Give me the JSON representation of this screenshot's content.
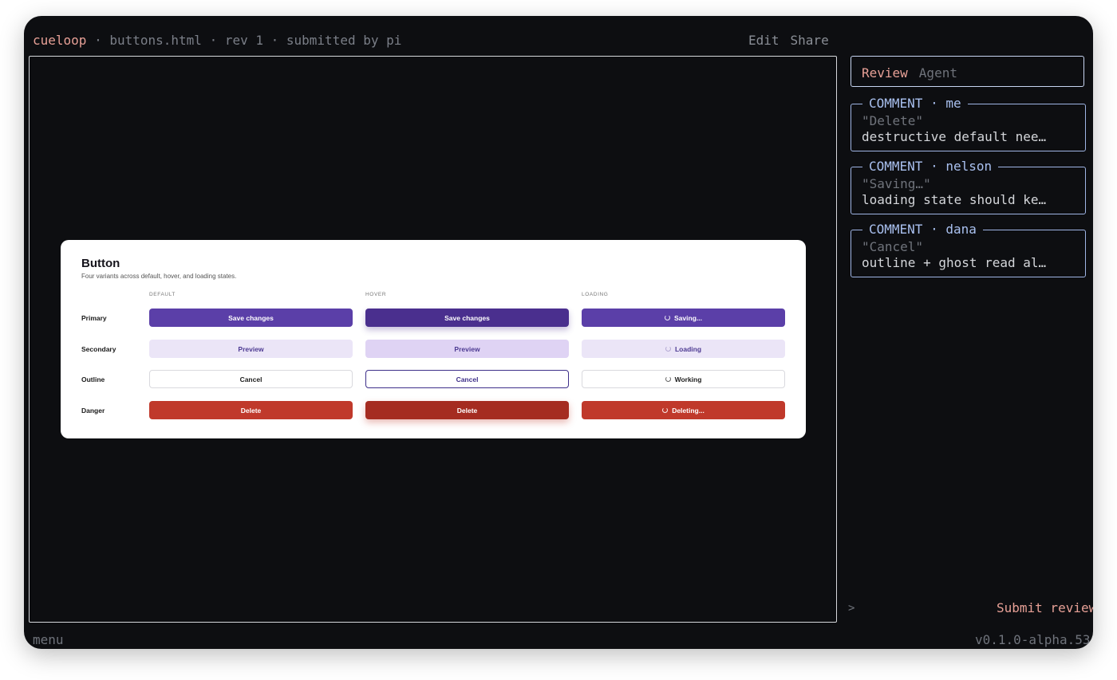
{
  "topbar": {
    "brand": "cueloop",
    "path": " · buttons.html · rev 1 · submitted by pi"
  },
  "actions": {
    "edit": "Edit",
    "share": "Share"
  },
  "preview": {
    "title": "Button",
    "subtitle": "Four variants across default, hover, and loading states.",
    "columns": [
      "DEFAULT",
      "HOVER",
      "LOADING"
    ],
    "rows": [
      {
        "label": "Primary",
        "default": "Save changes",
        "hover": "Save changes",
        "loading": "Saving..."
      },
      {
        "label": "Secondary",
        "default": "Preview",
        "hover": "Preview",
        "loading": "Loading"
      },
      {
        "label": "Outline",
        "default": "Cancel",
        "hover": "Cancel",
        "loading": "Working"
      },
      {
        "label": "Danger",
        "default": "Delete",
        "hover": "Delete",
        "loading": "Deleting..."
      }
    ]
  },
  "sidebar": {
    "tabs": {
      "review": "Review",
      "agent": "Agent"
    },
    "comments": [
      {
        "header": "COMMENT · me",
        "quote": "\"Delete\"",
        "body": "destructive default nee…"
      },
      {
        "header": "COMMENT · nelson",
        "quote": "\"Saving…\"",
        "body": "loading state should ke…"
      },
      {
        "header": "COMMENT · dana",
        "quote": "\"Cancel\"",
        "body": "outline + ghost read al…"
      }
    ],
    "prompt": ">",
    "submit": "Submit review"
  },
  "footer": {
    "menu": "menu",
    "version": "v0.1.0-alpha.53"
  },
  "colors": {
    "accent": "#e7a096",
    "primary": "#5b3fa8",
    "danger": "#c0392b",
    "comment_border": "#9fb5e5"
  }
}
